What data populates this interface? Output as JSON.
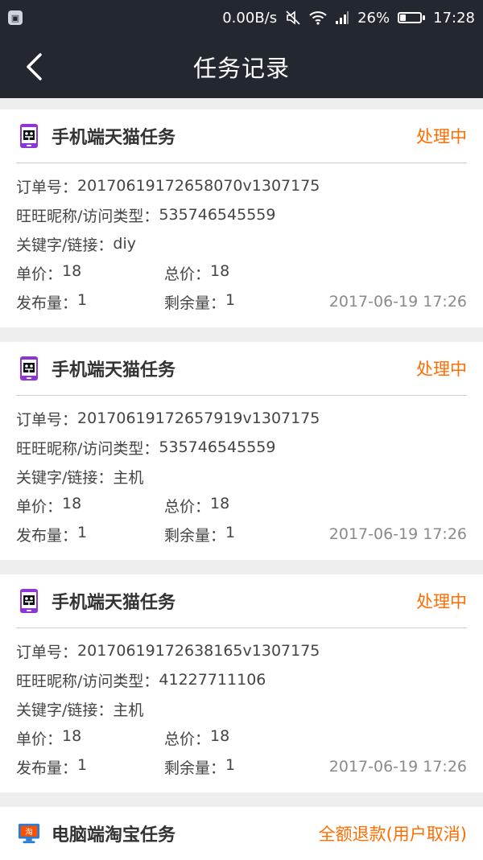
{
  "statusbar": {
    "speed": "0.00B/s",
    "battery_percent_text": "26%",
    "battery_level": 0.26,
    "time": "17:28",
    "icons": [
      "gallery-notification-icon",
      "mute-icon",
      "wifi-icon",
      "signal-icon",
      "battery-icon"
    ]
  },
  "navbar": {
    "title": "任务记录",
    "back_icon": "chevron-left-icon"
  },
  "labels": {
    "order_no": "订单号：",
    "wangwang": "旺旺昵称/访问类型：",
    "keyword": "关键字/链接：",
    "unit_price": "单价：",
    "total_price": "总价：",
    "publish": "发布量：",
    "remaining": "剩余量："
  },
  "tasks": [
    {
      "type": "手机端天猫任务",
      "icon": "tmall-mobile-icon",
      "status": "处理中",
      "order_no": "20170619172658070v1307175",
      "wangwang": "535746545559",
      "keyword": "diy",
      "unit_price": "18",
      "total_price": "18",
      "publish": "1",
      "remaining": "1",
      "date": "2017-06-19 17:26"
    },
    {
      "type": "手机端天猫任务",
      "icon": "tmall-mobile-icon",
      "status": "处理中",
      "order_no": "20170619172657919v1307175",
      "wangwang": "535746545559",
      "keyword": "主机",
      "unit_price": "18",
      "total_price": "18",
      "publish": "1",
      "remaining": "1",
      "date": "2017-06-19 17:26"
    },
    {
      "type": "手机端天猫任务",
      "icon": "tmall-mobile-icon",
      "status": "处理中",
      "order_no": "20170619172638165v1307175",
      "wangwang": "41227711106",
      "keyword": "主机",
      "unit_price": "18",
      "total_price": "18",
      "publish": "1",
      "remaining": "1",
      "date": "2017-06-19 17:26"
    },
    {
      "type": "电脑端淘宝任务",
      "icon": "taobao-pc-icon",
      "status": "全额退款(用户取消)"
    }
  ],
  "colors": {
    "header_bg": "#23272f",
    "status_orange": "#ff6d00",
    "tmall_purple": "#8e35d6",
    "taobao_orange": "#ff5000",
    "pc_blue": "#2a7fd4"
  }
}
